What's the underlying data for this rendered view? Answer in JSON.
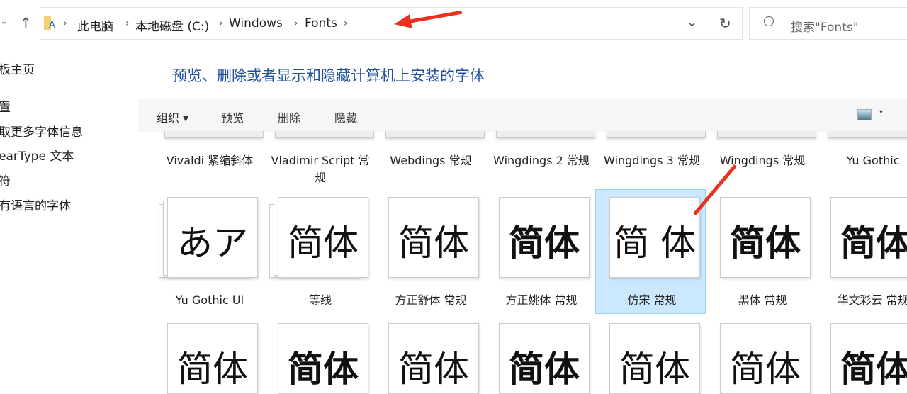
{
  "nav": {
    "back_chevron": "⌄",
    "up": "↑",
    "refresh": "↻",
    "dropdown": "⌄"
  },
  "breadcrumb": [
    "此电脑",
    "本地磁盘 (C:)",
    "Windows",
    "Fonts"
  ],
  "search": {
    "placeholder": "搜索\"Fonts\""
  },
  "sidebar": [
    "板主页",
    "置",
    "取更多字体信息",
    "earType 文本",
    "符",
    "有语言的字体"
  ],
  "title": "预览、删除或者显示和隐藏计算机上安装的字体",
  "toolbar": {
    "organize": "组织",
    "preview": "预览",
    "delete": "删除",
    "hide": "隐藏"
  },
  "row1": [
    "Vivaldi 紧缩斜体",
    "Vladimir Script 常规",
    "Webdings 常规",
    "Wingdings 2 常规",
    "Wingdings 3 常规",
    "Wingdings 常规",
    "Yu Gothic"
  ],
  "row2": [
    {
      "name": "Yu Gothic UI",
      "sample": "あア",
      "stack": true
    },
    {
      "name": "等线",
      "sample": "简体",
      "stack": true
    },
    {
      "name": "方正舒体 常规",
      "sample": "简体"
    },
    {
      "name": "方正姚体 常规",
      "sample": "简体"
    },
    {
      "name": "仿宋 常规",
      "sample": "简 体",
      "selected": true
    },
    {
      "name": "黑体 常规",
      "sample": "简体"
    },
    {
      "name": "华文彩云 常规",
      "sample": "简体"
    }
  ],
  "row3": [
    "简体",
    "简体",
    "简体",
    "简体",
    "简体",
    "简体",
    "简体"
  ],
  "colors": {
    "accent": "#1e4e9e",
    "selection": "#cce8ff",
    "arrow": "#e8321e"
  }
}
